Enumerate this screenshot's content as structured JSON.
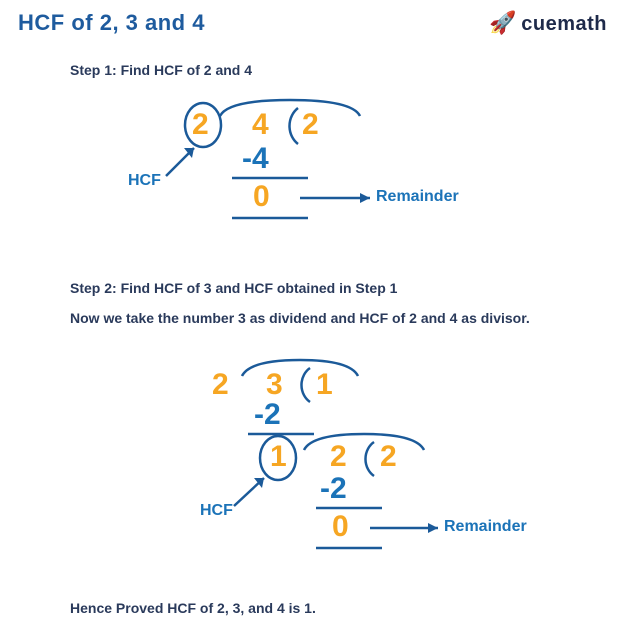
{
  "title": "HCF of 2, 3 and 4",
  "brand": "cuemath",
  "step1": "Step 1: Find HCF of 2 and 4",
  "step2a": "Step 2: Find HCF of 3 and HCF obtained in Step 1",
  "step2b": "Now we take the number 3 as dividend and HCF of 2 and 4 as divisor.",
  "proved": "Hence Proved HCF of 2, 3, and 4 is 1.",
  "label_hcf": "HCF",
  "label_rem": "Remainder",
  "d1": {
    "divisor": "2",
    "dividend": "4",
    "quotient": "2",
    "sub": "-4",
    "rem": "0"
  },
  "d2a": {
    "divisor": "2",
    "dividend": "3",
    "quotient": "1",
    "sub": "-2",
    "rem": "1"
  },
  "d2b": {
    "dividend": "2",
    "quotient": "2",
    "sub": "-2",
    "rem": "0"
  }
}
